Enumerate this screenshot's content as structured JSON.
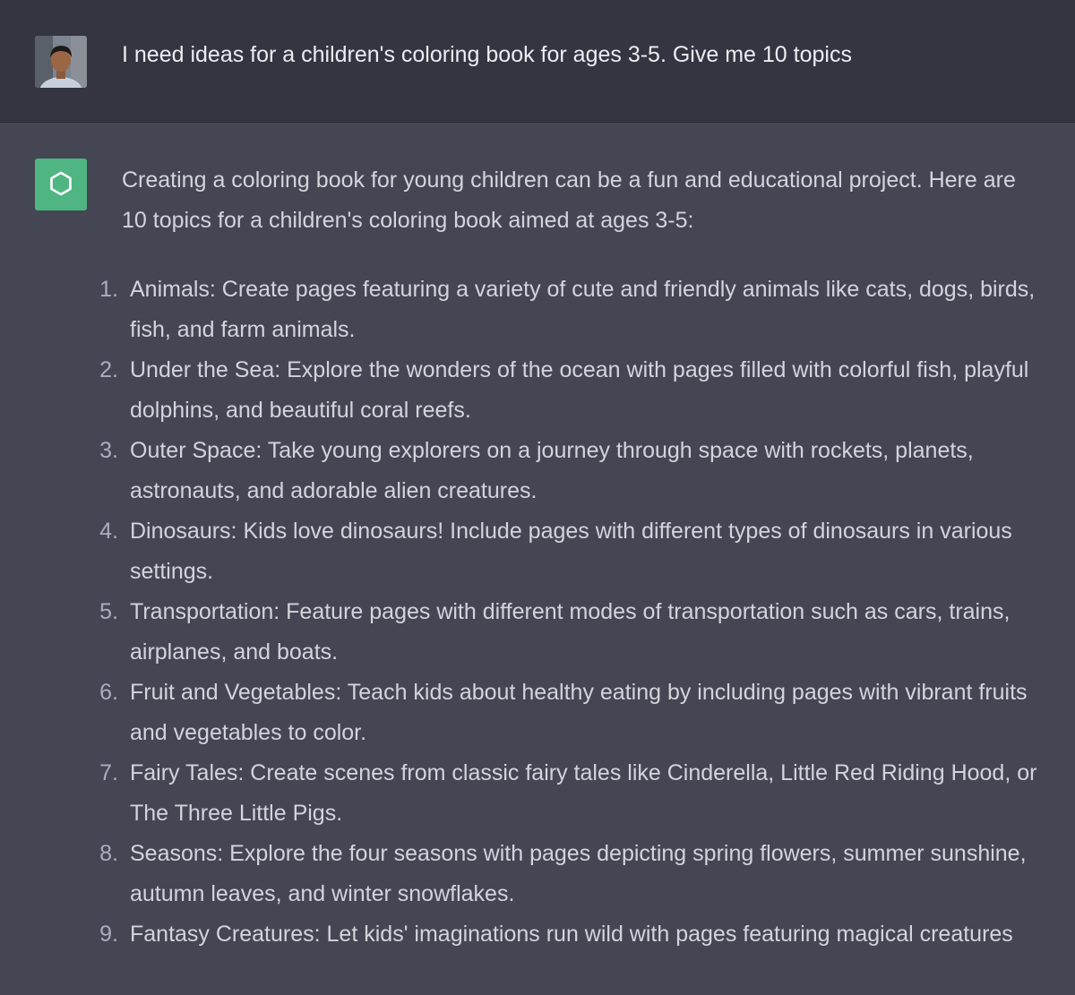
{
  "user_message": {
    "avatar": "user-avatar-photo",
    "text": "I need ideas for a children's coloring book for ages 3-5. Give me 10 topics"
  },
  "assistant_message": {
    "avatar": "openai-logo-icon",
    "avatar_color": "#4fb683",
    "intro_lines": [
      "Creating a coloring book for young children can be a fun and educational project. Here are",
      "10 topics for a children's coloring book aimed at ages 3-5:"
    ],
    "topics": [
      {
        "num": "1.",
        "lines": [
          "Animals: Create pages featuring a variety of cute and friendly animals like cats, dogs, birds,",
          "fish, and farm animals."
        ]
      },
      {
        "num": "2.",
        "lines": [
          "Under the Sea: Explore the wonders of the ocean with pages filled with colorful fish, playful",
          "dolphins, and beautiful coral reefs."
        ]
      },
      {
        "num": "3.",
        "lines": [
          "Outer Space: Take young explorers on a journey through space with rockets, planets,",
          "astronauts, and adorable alien creatures."
        ]
      },
      {
        "num": "4.",
        "lines": [
          "Dinosaurs: Kids love dinosaurs! Include pages with different types of dinosaurs in various",
          "settings."
        ]
      },
      {
        "num": "5.",
        "lines": [
          "Transportation: Feature pages with different modes of transportation such as cars, trains,",
          "airplanes, and boats."
        ]
      },
      {
        "num": "6.",
        "lines": [
          "Fruit and Vegetables: Teach kids about healthy eating by including pages with vibrant fruits",
          "and vegetables to color."
        ]
      },
      {
        "num": "7.",
        "lines": [
          "Fairy Tales: Create scenes from classic fairy tales like Cinderella, Little Red Riding Hood, or",
          "The Three Little Pigs."
        ]
      },
      {
        "num": "8.",
        "lines": [
          "Seasons: Explore the four seasons with pages depicting spring flowers, summer sunshine,",
          "autumn leaves, and winter snowflakes."
        ]
      },
      {
        "num": "9.",
        "lines": [
          "Fantasy Creatures: Let kids' imaginations run wild with pages featuring magical creatures"
        ]
      }
    ]
  },
  "colors": {
    "user_bg": "#343541",
    "assistant_bg": "#444654",
    "text": "#d1d5db",
    "list_number": "#acacbe"
  }
}
